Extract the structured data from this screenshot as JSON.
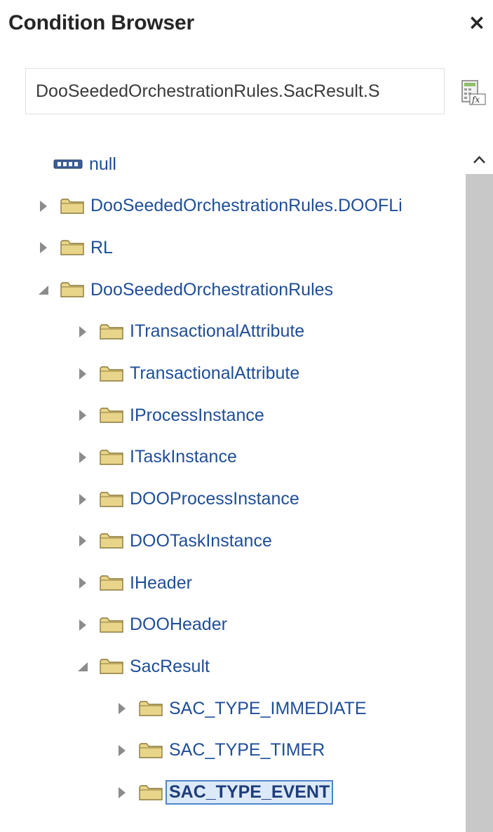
{
  "panel": {
    "title": "Condition Browser",
    "close_label": "×"
  },
  "search": {
    "value": "DooSeededOrchestrationRules.SacResult.S"
  },
  "tree": {
    "items": [
      {
        "label": "null",
        "icon": "xyz-type-icon",
        "expander": "none",
        "depth": 0,
        "selected": false
      },
      {
        "label": "DooSeededOrchestrationRules.DOOFLi",
        "icon": "folder-icon",
        "expander": "collapsed",
        "depth": 0,
        "selected": false
      },
      {
        "label": "RL",
        "icon": "folder-icon",
        "expander": "collapsed",
        "depth": 0,
        "selected": false
      },
      {
        "label": "DooSeededOrchestrationRules",
        "icon": "folder-icon",
        "expander": "expanded",
        "depth": 0,
        "selected": false
      },
      {
        "label": "ITransactionalAttribute",
        "icon": "folder-icon",
        "expander": "collapsed",
        "depth": 1,
        "selected": false
      },
      {
        "label": "TransactionalAttribute",
        "icon": "folder-icon",
        "expander": "collapsed",
        "depth": 1,
        "selected": false
      },
      {
        "label": "IProcessInstance",
        "icon": "folder-icon",
        "expander": "collapsed",
        "depth": 1,
        "selected": false
      },
      {
        "label": "ITaskInstance",
        "icon": "folder-icon",
        "expander": "collapsed",
        "depth": 1,
        "selected": false
      },
      {
        "label": "DOOProcessInstance",
        "icon": "folder-icon",
        "expander": "collapsed",
        "depth": 1,
        "selected": false
      },
      {
        "label": "DOOTaskInstance",
        "icon": "folder-icon",
        "expander": "collapsed",
        "depth": 1,
        "selected": false
      },
      {
        "label": "IHeader",
        "icon": "folder-icon",
        "expander": "collapsed",
        "depth": 1,
        "selected": false
      },
      {
        "label": "DOOHeader",
        "icon": "folder-icon",
        "expander": "collapsed",
        "depth": 1,
        "selected": false
      },
      {
        "label": "SacResult",
        "icon": "folder-icon",
        "expander": "expanded",
        "depth": 1,
        "selected": false
      },
      {
        "label": "SAC_TYPE_IMMEDIATE",
        "icon": "folder-icon",
        "expander": "collapsed",
        "depth": 2,
        "selected": false
      },
      {
        "label": "SAC_TYPE_TIMER",
        "icon": "folder-icon",
        "expander": "collapsed",
        "depth": 2,
        "selected": false
      },
      {
        "label": "SAC_TYPE_EVENT",
        "icon": "folder-icon",
        "expander": "collapsed",
        "depth": 2,
        "selected": true
      }
    ]
  },
  "colors": {
    "link": "#1f4e99",
    "folder_fill": "#e9d58a",
    "folder_stroke": "#8a7a3c",
    "selection_bg": "#dce9f8",
    "selection_border": "#4d86c9",
    "scrollbar_track": "#c8c8c8"
  }
}
